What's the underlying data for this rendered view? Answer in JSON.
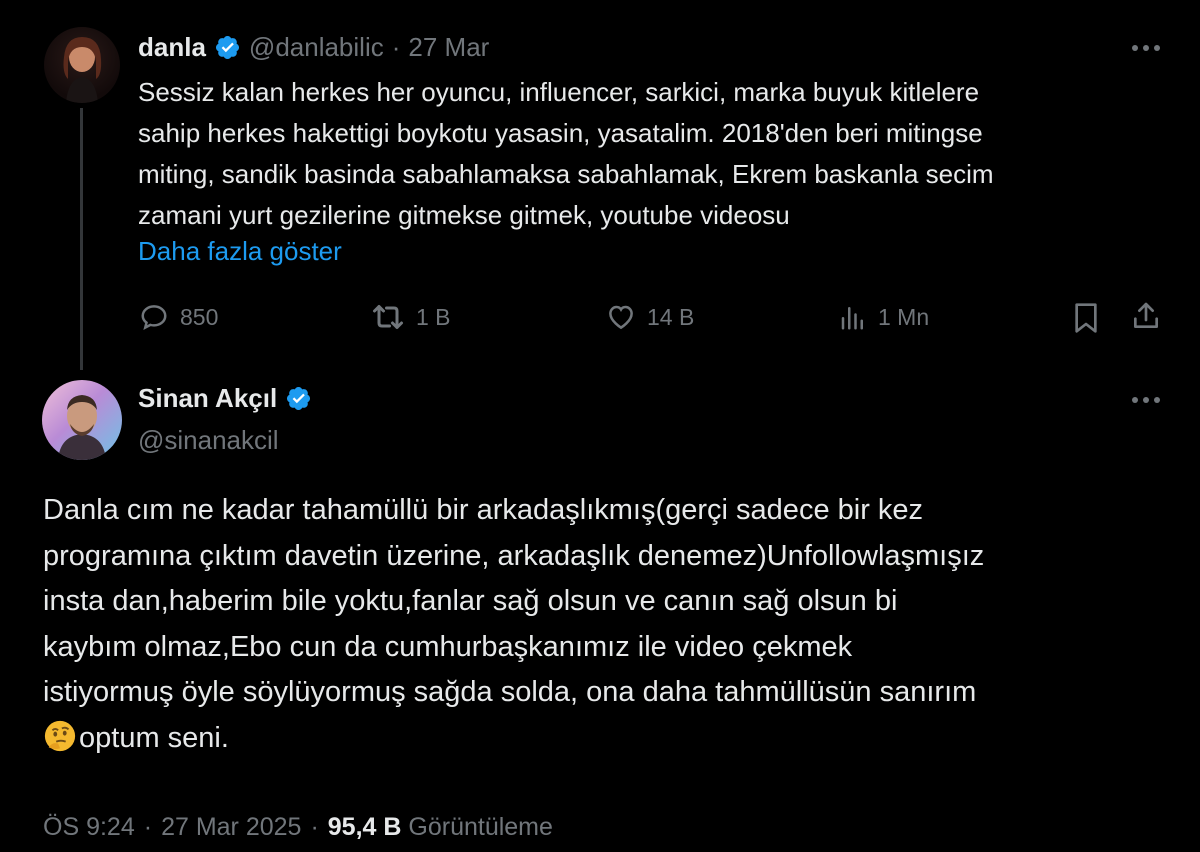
{
  "reply_to_tweet": {
    "author_name": "danla",
    "author_handle": "@danlabilic",
    "separator": "·",
    "date": "27 Mar",
    "text_lines": [
      "Sessiz kalan herkes her oyuncu, influencer, sarkici, marka buyuk kitlelere",
      "sahip herkes hakettigi boykotu yasasin, yasatalim. 2018'den beri mitingse",
      "miting, sandik basinda sabahlamaksa sabahlamak, Ekrem baskanla secim",
      "zamani yurt gezilerine gitmekse gitmek, youtube videosu"
    ],
    "show_more": "Daha fazla göster",
    "actions": {
      "replies": "850",
      "reposts": "1 B",
      "likes": "14 B",
      "views": "1 Mn"
    }
  },
  "main_tweet": {
    "author_name": "Sinan Akçıl",
    "author_handle": "@sinanakcil",
    "text_lines": [
      "Danla cım ne kadar tahamüllü bir arkadaşlıkmış(gerçi sadece bir kez",
      "programına çıktım davetin üzerine, arkadaşlık denemez)Unfollowlaşmışız",
      "insta dan,haberim bile yoktu,fanlar sağ olsun ve canın sağ olsun bi",
      "kaybım olmaz,Ebo cun da cumhurbaşkanımız ile video çekmek",
      "istiyormuş öyle söylüyormuş sağda solda, ona daha tahmüllüsün sanırım"
    ],
    "last_line_text": "optum seni.",
    "meta": {
      "time": "ÖS 9:24",
      "sep1": "·",
      "date": "27 Mar 2025",
      "sep2": "·",
      "views_count": "95,4 B",
      "views_label": "Görüntüleme"
    }
  },
  "colors": {
    "background": "#000000",
    "text": "#e7e9ea",
    "secondary": "#71767b",
    "accent": "#1d9bf0",
    "thread_line": "#333639"
  },
  "icons": [
    "verified-badge-icon",
    "more-icon",
    "reply-icon",
    "repost-icon",
    "like-icon",
    "views-icon",
    "bookmark-icon",
    "share-icon",
    "thinking-emoji-icon"
  ]
}
